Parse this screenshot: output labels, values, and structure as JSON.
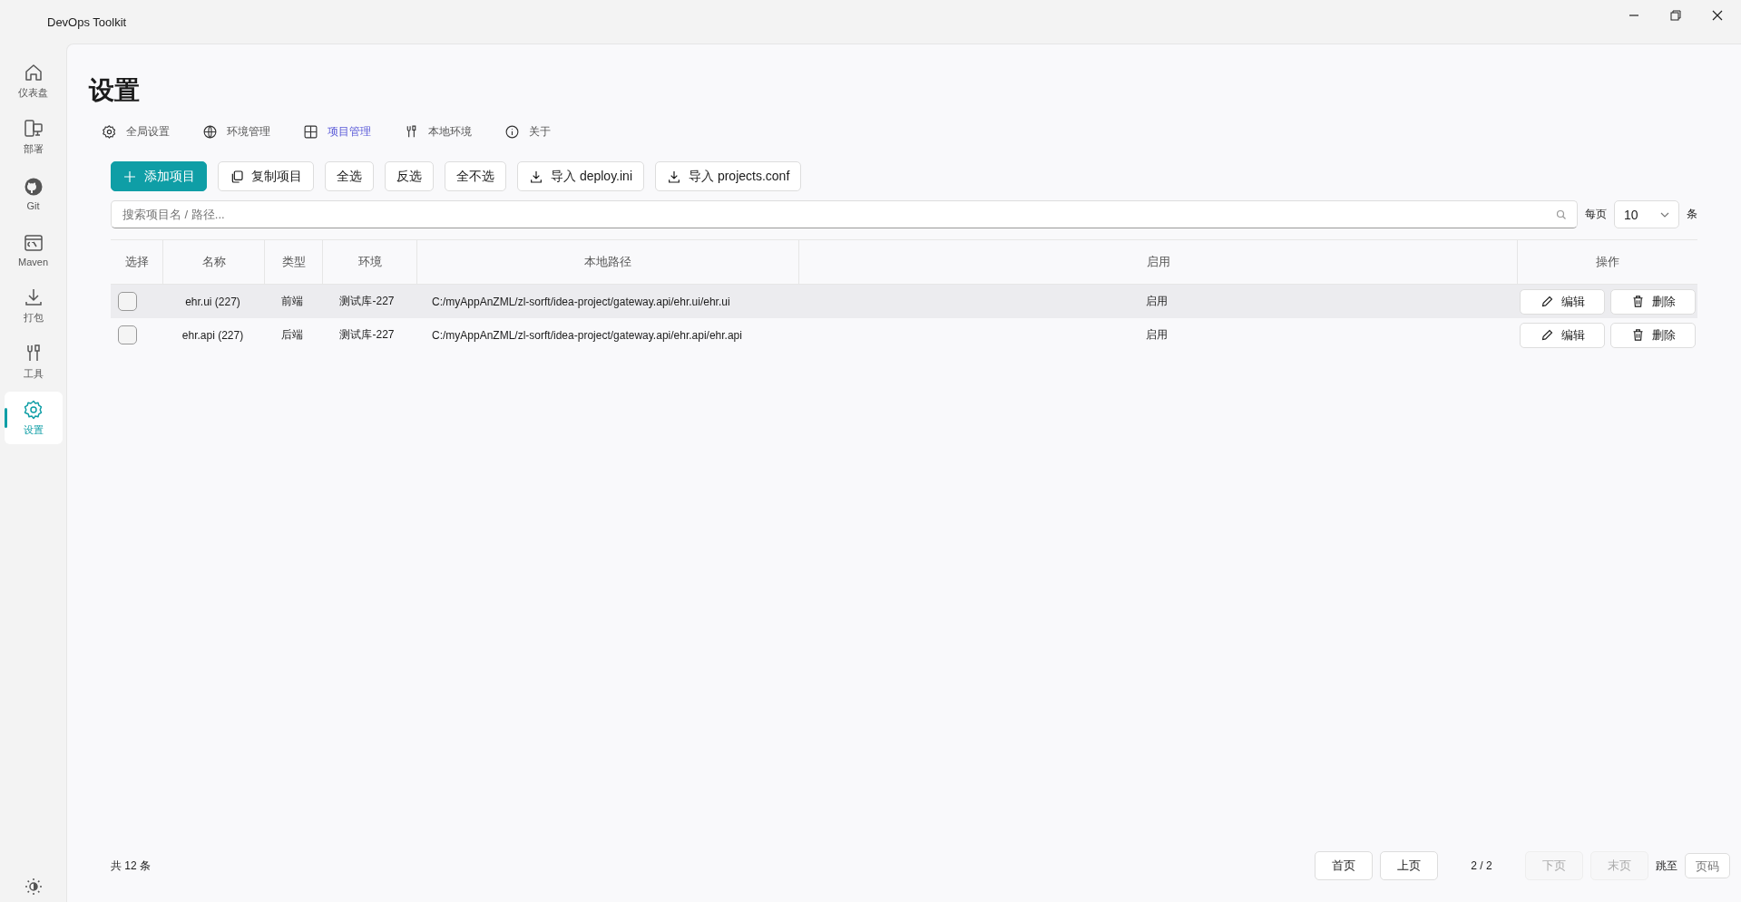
{
  "window": {
    "title": "DevOps Toolkit"
  },
  "sidebar": {
    "items": [
      {
        "label": "仪表盘",
        "selected": false
      },
      {
        "label": "部署",
        "selected": false
      },
      {
        "label": "Git",
        "selected": false
      },
      {
        "label": "Maven",
        "selected": false
      },
      {
        "label": "打包",
        "selected": false
      },
      {
        "label": "工具",
        "selected": false
      },
      {
        "label": "设置",
        "selected": true
      }
    ]
  },
  "page": {
    "title": "设置"
  },
  "tabs": [
    {
      "label": "全局设置",
      "selected": false
    },
    {
      "label": "环境管理",
      "selected": false
    },
    {
      "label": "项目管理",
      "selected": true
    },
    {
      "label": "本地环境",
      "selected": false
    },
    {
      "label": "关于",
      "selected": false
    }
  ],
  "toolbar": [
    {
      "label": "添加项目",
      "kind": "primary"
    },
    {
      "label": "复制项目",
      "kind": "normal"
    },
    {
      "label": "全选",
      "kind": "normal"
    },
    {
      "label": "反选",
      "kind": "normal"
    },
    {
      "label": "全不选",
      "kind": "normal"
    },
    {
      "label": "导入 deploy.ini",
      "kind": "normal"
    },
    {
      "label": "导入 projects.conf",
      "kind": "normal"
    }
  ],
  "search": {
    "placeholder": "搜索项目名 / 路径..."
  },
  "page_size": {
    "label": "每页",
    "value": "10",
    "unit": "条"
  },
  "table": {
    "columns": [
      "选择",
      "名称",
      "类型",
      "环境",
      "本地路径",
      "启用",
      "操作"
    ],
    "rows": [
      {
        "checked": false,
        "hovered": true,
        "name": "ehr.ui (227)",
        "type": "前端",
        "env": "测试库-227",
        "path": "C:/myAppAnZML/zl-sorft/idea-project/gateway.api/ehr.ui/ehr.ui",
        "enabled": "启用",
        "actions": [
          "编辑",
          "删除"
        ]
      },
      {
        "checked": false,
        "hovered": false,
        "name": "ehr.api (227)",
        "type": "后端",
        "env": "测试库-227",
        "path": "C:/myAppAnZML/zl-sorft/idea-project/gateway.api/ehr.api/ehr.api",
        "enabled": "启用",
        "actions": [
          "编辑",
          "删除"
        ]
      }
    ]
  },
  "footer": {
    "total": "共 12 条",
    "pager": [
      {
        "label": "首页",
        "disabled": false
      },
      {
        "label": "上页",
        "disabled": false
      },
      {
        "label": "2 / 2",
        "kind": "text"
      },
      {
        "label": "下页",
        "disabled": true
      },
      {
        "label": "末页",
        "disabled": true
      }
    ],
    "jump_label": "跳至",
    "jump_placeholder": "页码"
  }
}
